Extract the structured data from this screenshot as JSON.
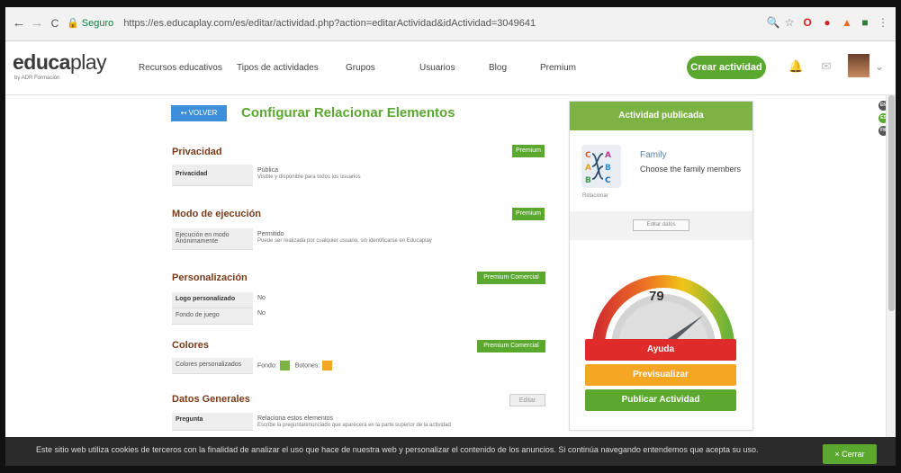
{
  "browser": {
    "back": "←",
    "forward": "→",
    "reload": "C",
    "secure_label": "Seguro",
    "url": "https://es.educaplay.com/es/editar/actividad.php?action=editarActividad&idActividad=3049641",
    "icons": [
      "search-icon",
      "star-icon",
      "opera-icon",
      "pinterest-icon",
      "extension-icon",
      "extension-icon",
      "menu-icon"
    ]
  },
  "header": {
    "logo_main": "educa",
    "logo_play": "play",
    "logo_sub": "by ADR Formación",
    "nav": [
      "Recursos educativos",
      "Tipos de actividades",
      "Grupos",
      "Usuarios",
      "Blog",
      "Premium"
    ],
    "cta": "Crear actividad"
  },
  "page": {
    "back_button": "VOLVER",
    "title": "Configurar Relacionar Elementos"
  },
  "sections": {
    "privacidad": {
      "title": "Privacidad",
      "badge": "Premium",
      "row_label": "Privacidad",
      "value": "Pública",
      "value_note": "Visible y disponible para todos los usuarios"
    },
    "modo": {
      "title": "Modo de ejecución",
      "badge": "Premium",
      "row_label_1": "Ejecución en modo",
      "row_label_2": "Anónimamente",
      "value": "Permitido",
      "value_note": "Puede ser realizada por cualquier usuario, sin identificarse en Educaplay"
    },
    "personalizacion": {
      "title": "Personalización",
      "badge": "Premium Comercial",
      "rows": [
        {
          "label": "Logo personalizado",
          "value": "No"
        },
        {
          "label": "Fondo de juego",
          "value": "No"
        }
      ]
    },
    "colores": {
      "title": "Colores",
      "badge": "Premium Comercial",
      "row_label": "Colores personalizados",
      "fondo_label": "Fondo:",
      "botones_label": "Botones:",
      "fondo_color": "#7cb342",
      "botones_color": "#f5a623"
    },
    "datos": {
      "title": "Datos Generales",
      "badge": "Editar",
      "row_label": "Pregunta",
      "value": "Relaciona estos elementos",
      "value_note": "Escribe la pregunta/enunciado que aparecerá en la parte superior de la actividad"
    }
  },
  "panel": {
    "head": "Actividad publicada",
    "thumb_caption": "Relacionar",
    "activity_title": "Family",
    "activity_desc": "Choose the family members",
    "edit_button": "Editar datos",
    "gauge_value": "79",
    "gauge_fraction": 0.79,
    "buttons": [
      {
        "label": "Ayuda",
        "color": "#e02b2b"
      },
      {
        "label": "Previsualizar",
        "color": "#f5a623"
      },
      {
        "label": "Publicar Actividad",
        "color": "#5ba82f"
      }
    ]
  },
  "languages": [
    "EN",
    "ES",
    "FR"
  ],
  "cookie": {
    "text": "Este sitio web utiliza cookies de terceros con la finalidad de analizar el uso que hace de nuestra web y personalizar el contenido de los anuncios. Si continúa navegando entendemos que acepta su uso.",
    "button": "× Cerrar"
  },
  "colors": {
    "accent": "#5ba82f",
    "title": "#7a3b1a",
    "link": "#3d8fdb"
  }
}
